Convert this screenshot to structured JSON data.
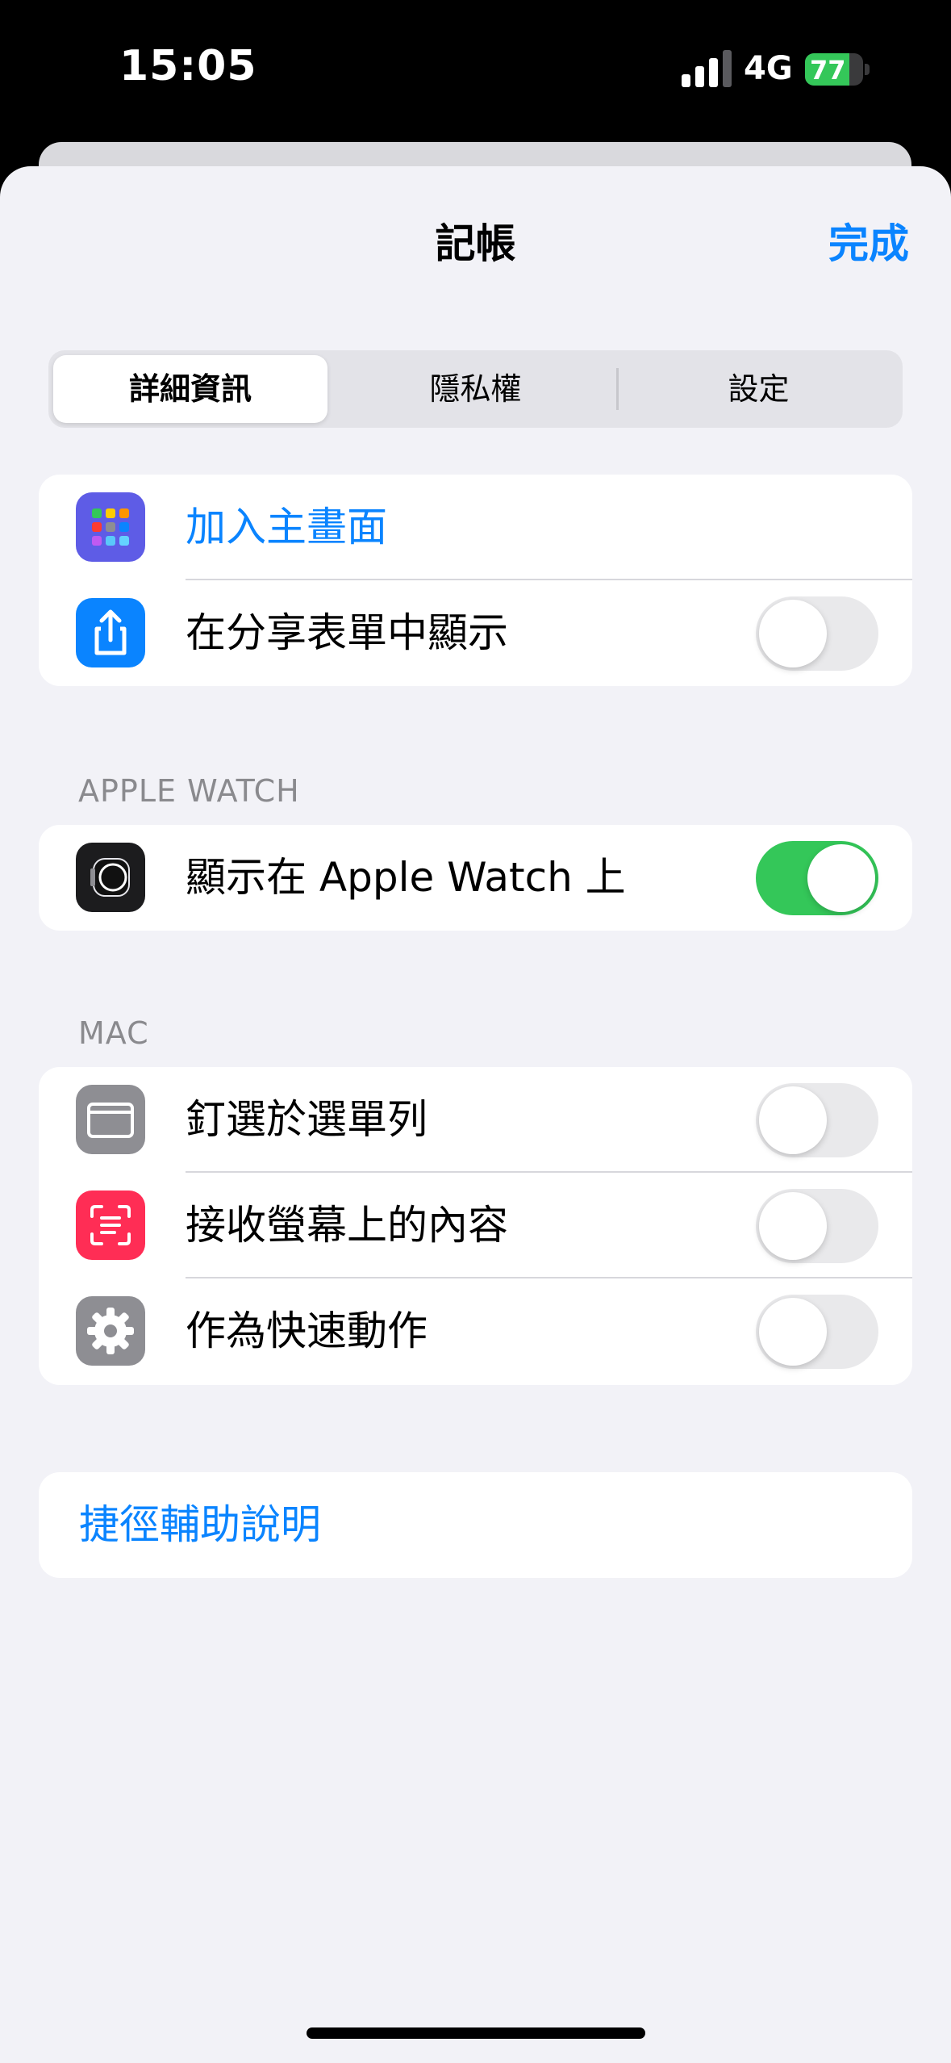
{
  "status_bar": {
    "time": "15:05",
    "network": "4G",
    "battery": "77",
    "battery_level": 0.77,
    "signal_bars": 3,
    "signal_bars_total": 4
  },
  "nav": {
    "title": "記帳",
    "done": "完成"
  },
  "tabs": [
    {
      "label": "詳細資訊",
      "selected": true
    },
    {
      "label": "隱私權",
      "selected": false
    },
    {
      "label": "設定",
      "selected": false
    }
  ],
  "general_group": {
    "add_home": {
      "label": "加入主畫面",
      "icon": "app-grid-icon"
    },
    "share_sheet": {
      "label": "在分享表單中顯示",
      "icon": "share-icon",
      "toggle": false
    }
  },
  "apple_watch": {
    "header": "APPLE WATCH",
    "show_on_watch": {
      "label": "顯示在 Apple Watch 上",
      "icon": "apple-watch-icon",
      "toggle": true
    }
  },
  "mac": {
    "header": "MAC",
    "items": [
      {
        "label": "釘選於選單列",
        "icon": "menu-bar-icon",
        "toggle": false
      },
      {
        "label": "接收螢幕上的內容",
        "icon": "screen-content-icon",
        "toggle": false
      },
      {
        "label": "作為快速動作",
        "icon": "gear-icon",
        "toggle": false
      }
    ]
  },
  "help": {
    "label": "捷徑輔助說明"
  },
  "colors": {
    "accent": "#0a84ff",
    "toggle_on": "#34c759",
    "background": "#f2f2f7"
  }
}
